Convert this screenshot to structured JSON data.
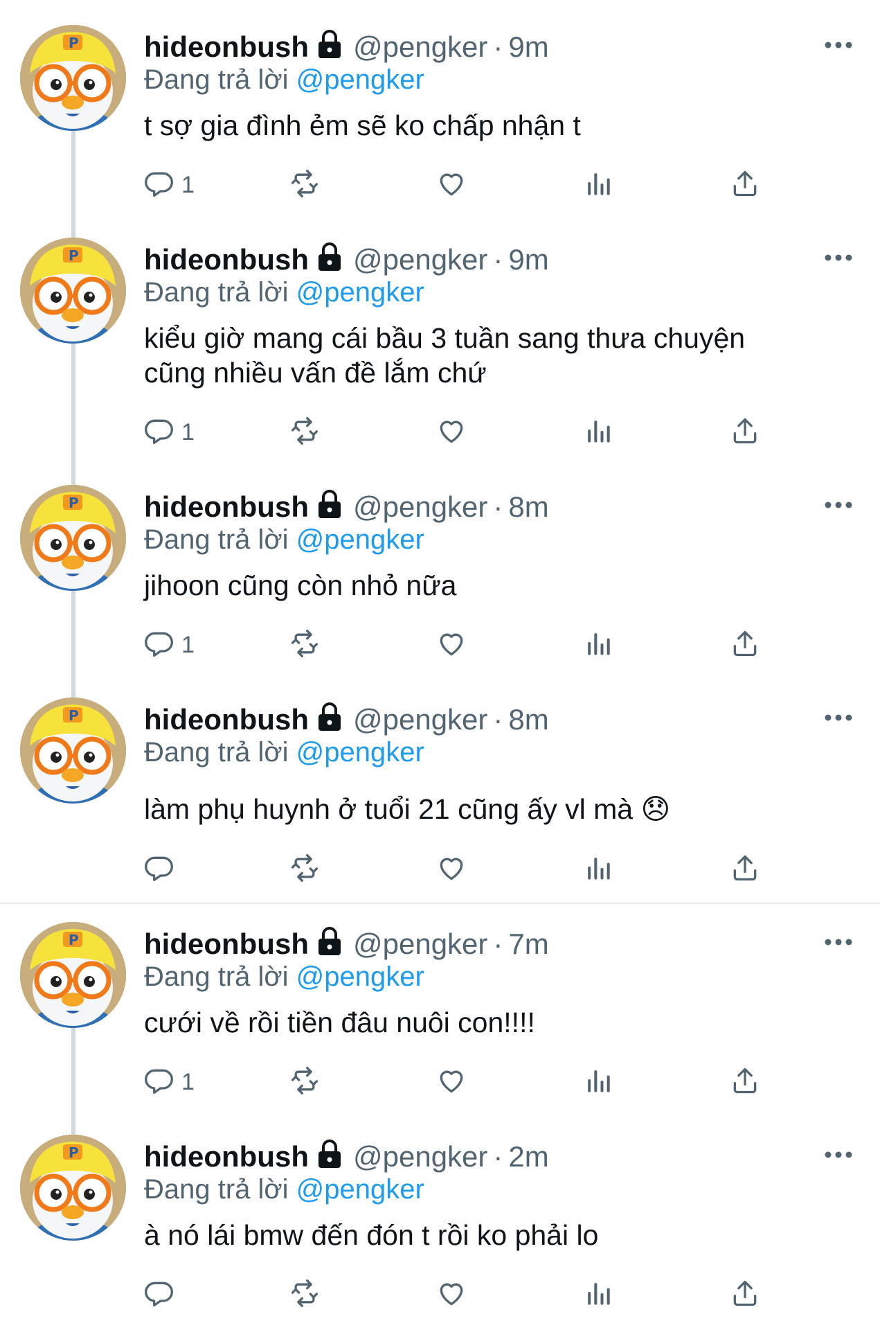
{
  "tweets": [
    {
      "name": "hideonbush",
      "handle": "@pengker",
      "time": "9m",
      "replying_prefix": "Đang trả lời",
      "replying_mention": "@pengker",
      "text": "t sợ gia đình ẻm sẽ ko chấp nhận t",
      "reply_count": "1"
    },
    {
      "name": "hideonbush",
      "handle": "@pengker",
      "time": "9m",
      "replying_prefix": "Đang trả lời",
      "replying_mention": "@pengker",
      "text": "kiểu giờ mang cái bầu 3 tuần sang thưa chuyện cũng nhiều vấn đề lắm chứ",
      "reply_count": "1"
    },
    {
      "name": "hideonbush",
      "handle": "@pengker",
      "time": "8m",
      "replying_prefix": "Đang trả lời",
      "replying_mention": "@pengker",
      "text": "jihoon cũng còn nhỏ nữa",
      "reply_count": "1"
    },
    {
      "name": "hideonbush",
      "handle": "@pengker",
      "time": "8m",
      "replying_prefix": "Đang trả lời",
      "replying_mention": "@pengker",
      "text": "làm phụ huynh ở tuổi 21 cũng ấy vl mà 😞",
      "reply_count": ""
    },
    {
      "name": "hideonbush",
      "handle": "@pengker",
      "time": "7m",
      "replying_prefix": "Đang trả lời",
      "replying_mention": "@pengker",
      "text": "cưới về rồi tiền đâu nuôi con!!!!",
      "reply_count": "1"
    },
    {
      "name": "hideonbush",
      "handle": "@pengker",
      "time": "2m",
      "replying_prefix": "Đang trả lời",
      "replying_mention": "@pengker",
      "text": "à nó lái bmw đến đón t rồi ko phải lo",
      "reply_count": ""
    }
  ],
  "icons": {
    "reply": "reply-icon",
    "retweet": "retweet-icon",
    "like": "heart-icon",
    "views": "analytics-icon",
    "share": "share-icon",
    "more": "more-icon",
    "protected": "lock-icon"
  },
  "colors": {
    "mention": "#1d9bf0",
    "secondary_text": "#536471",
    "thread_line": "#cfd9de"
  }
}
